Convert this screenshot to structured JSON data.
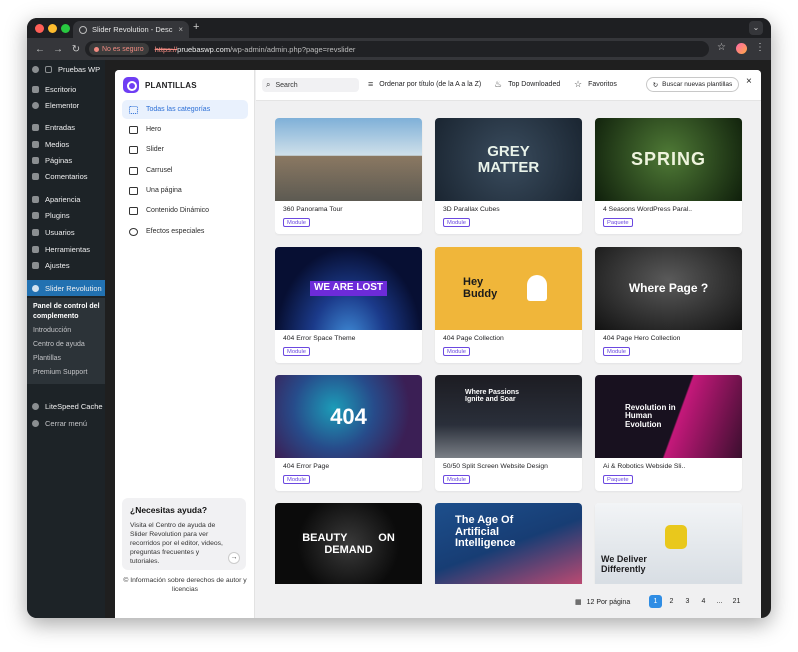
{
  "browser": {
    "tab_title": "Slider Revolution - Descripció",
    "tab_close": "×",
    "new_tab": "+",
    "security_label": "No es seguro",
    "url_scheme": "https://",
    "url_host": "pruebaswp.com",
    "url_path": "/wp-admin/admin.php?page=revslider"
  },
  "wp": {
    "site_name": "Pruebas WP",
    "menu": [
      {
        "label": "Escritorio",
        "icon": "dashboard-icon"
      },
      {
        "label": "Elementor",
        "icon": "elementor-icon"
      },
      {
        "label": "Entradas",
        "icon": "pin-icon"
      },
      {
        "label": "Medios",
        "icon": "media-icon"
      },
      {
        "label": "Páginas",
        "icon": "pages-icon"
      },
      {
        "label": "Comentarios",
        "icon": "comments-icon"
      },
      {
        "label": "Apariencia",
        "icon": "brush-icon"
      },
      {
        "label": "Plugins",
        "icon": "plugin-icon"
      },
      {
        "label": "Usuarios",
        "icon": "users-icon"
      },
      {
        "label": "Herramientas",
        "icon": "tools-icon"
      },
      {
        "label": "Ajustes",
        "icon": "settings-icon"
      },
      {
        "label": "Slider Revolution",
        "icon": "revslider-icon"
      },
      {
        "label": "LiteSpeed Cache",
        "icon": "litespeed-icon"
      },
      {
        "label": "Cerrar menú",
        "icon": "collapse-icon"
      }
    ],
    "submenu": {
      "title": "Panel de control del complemento",
      "items": [
        "Introducción",
        "Centro de ayuda",
        "Plantillas",
        "Premium Support"
      ]
    }
  },
  "modal": {
    "title": "PLANTILLAS",
    "categories": [
      {
        "label": "Todas las categorías",
        "icon": "grid-icon"
      },
      {
        "label": "Hero",
        "icon": "image-icon"
      },
      {
        "label": "Slider",
        "icon": "slider-icon"
      },
      {
        "label": "Carrusel",
        "icon": "carousel-icon"
      },
      {
        "label": "Una página",
        "icon": "onepage-icon"
      },
      {
        "label": "Contenido Dinámico",
        "icon": "dynamic-icon"
      },
      {
        "label": "Efectos especiales",
        "icon": "effects-icon"
      }
    ],
    "search_placeholder": "Search",
    "sort_label": "Ordenar por título (de la A a la Z)",
    "top_downloaded": "Top Downloaded",
    "favorites": "Favoritos",
    "buscar": "Buscar nuevas plantillas",
    "close": "×",
    "help": {
      "title": "¿Necesitas ayuda?",
      "text": "Visita el Centro de ayuda de Slider Revolution para ver recorridos por el editor, videos, preguntas frecuentes y tutoriales.",
      "copyright": "© Información sobre derechos de autor y licencias"
    },
    "templates": [
      {
        "name": "360 Panorama Tour",
        "badge": "Module",
        "thumb_text": "",
        "bg": "#7fb0d8",
        "accent": "#6b5a48"
      },
      {
        "name": "3D Parallax Cubes",
        "badge": "Module",
        "thumb_text": "GREY MATTER",
        "bg": "#1e2b3a",
        "accent": "#c7cfd6"
      },
      {
        "name": "4 Seasons WordPress Paral..",
        "badge": "Paquete",
        "thumb_text": "SPRING",
        "bg": "#1f3b1c",
        "accent": "#e9f1d7"
      },
      {
        "name": "404 Error Space Theme",
        "badge": "Module",
        "thumb_text": "WE ARE LOST",
        "bg": "#0d1b4a",
        "accent": "#6d2bd9"
      },
      {
        "name": "404 Page Collection",
        "badge": "Module",
        "thumb_text": "Hey Buddy",
        "bg": "#f0b63a",
        "accent": "#ffffff"
      },
      {
        "name": "404 Page Hero Collection",
        "badge": "Module",
        "thumb_text": "Where Page ?",
        "bg": "#1b1b1b",
        "accent": "#8a8a8a"
      },
      {
        "name": "404 Error Page",
        "badge": "Module",
        "thumb_text": "404",
        "bg": "#0c6b8e",
        "accent": "#4b2a7a"
      },
      {
        "name": "50/50 Split Screen Website Design",
        "badge": "Module",
        "thumb_text": "Where Passions Ignite and Soar",
        "bg": "#1c1c22",
        "accent": "#3a7bb8"
      },
      {
        "name": "Ai & Robotics Webside Sli..",
        "badge": "Paquete",
        "thumb_text": "Revolution in Human Evolution",
        "bg": "#18111f",
        "accent": "#c4187a"
      },
      {
        "name": "",
        "badge": "",
        "thumb_text": "BEAUTY ON DEMAND",
        "bg": "#0e0e0e",
        "accent": "#2a2a2a"
      },
      {
        "name": "",
        "badge": "",
        "thumb_text": "The Age Of Artificial Intelligence",
        "bg": "#173d74",
        "accent": "#c04a72"
      },
      {
        "name": "",
        "badge": "",
        "thumb_text": "We Deliver Differently",
        "bg": "#dfe4ea",
        "accent": "#e9c81c"
      }
    ],
    "per_page": "12 Por página",
    "pages": [
      "1",
      "2",
      "3",
      "4",
      "...",
      "21"
    ],
    "current_page": "1"
  }
}
